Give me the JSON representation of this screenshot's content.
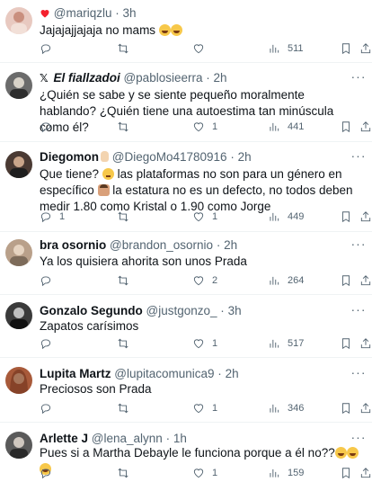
{
  "colors": {
    "text": "#0f1419",
    "muted": "#536471",
    "divider": "#eff3f4",
    "heart": "#f4212e"
  },
  "tweets": [
    {
      "name": "",
      "handle": "@mariqzlu",
      "time": "3h",
      "text": "Jajajajjajaja no mams",
      "emoji": [
        "rofl",
        "rofl"
      ],
      "replies": "",
      "retweets": "",
      "likes": "",
      "views": "511",
      "avatar_color": "#e8c9c0"
    },
    {
      "name": "El fiallzadoi",
      "handle": "@pablosieerra",
      "time": "2h",
      "text": "¿Quién se sabe y se siente pequeño moralmente hablando? ¿Quién tiene una autoestima tan minúscula como él?",
      "replies": "",
      "retweets": "",
      "likes": "1",
      "views": "441",
      "avatar_color": "#6b6b6b"
    },
    {
      "name": "Diegomon",
      "handle": "@DiegoMo41780916",
      "time": "2h",
      "text_part1": "Que tiene?",
      "text_part2": " las plataformas no son para un género en específico ",
      "text_part3": " la estatura no es un defecto, no todos deben medir 1.80 como Kristal o 1.90 como Jorge",
      "replies": "1",
      "retweets": "",
      "likes": "1",
      "views": "449",
      "avatar_color": "#4a3a33"
    },
    {
      "name": "bra osornio",
      "handle": "@brandon_osornio",
      "time": "2h",
      "text": "Ya los quisiera ahorita son unos Prada",
      "replies": "",
      "retweets": "",
      "likes": "2",
      "views": "264",
      "avatar_color": "#b9a08a"
    },
    {
      "name": "Gonzalo Segundo",
      "handle": "@justgonzo_",
      "time": "3h",
      "text": "Zapatos carísimos",
      "replies": "",
      "retweets": "",
      "likes": "1",
      "views": "517",
      "avatar_color": "#3a3a3a"
    },
    {
      "name": "Lupita Martz",
      "handle": "@lupitacomunica9",
      "time": "2h",
      "text": "Preciosos son Prada",
      "replies": "",
      "retweets": "",
      "likes": "1",
      "views": "346",
      "avatar_color": "#a85a3a"
    },
    {
      "name": "Arlette J",
      "handle": "@lena_alynn",
      "time": "1h",
      "text": "Pues si a Martha Debayle le funciona porque a él no??",
      "emoji": [
        "rofl",
        "rofl",
        "rofl"
      ],
      "replies": "",
      "retweets": "",
      "likes": "1",
      "views": "159",
      "avatar_color": "#5a5a5a"
    }
  ]
}
